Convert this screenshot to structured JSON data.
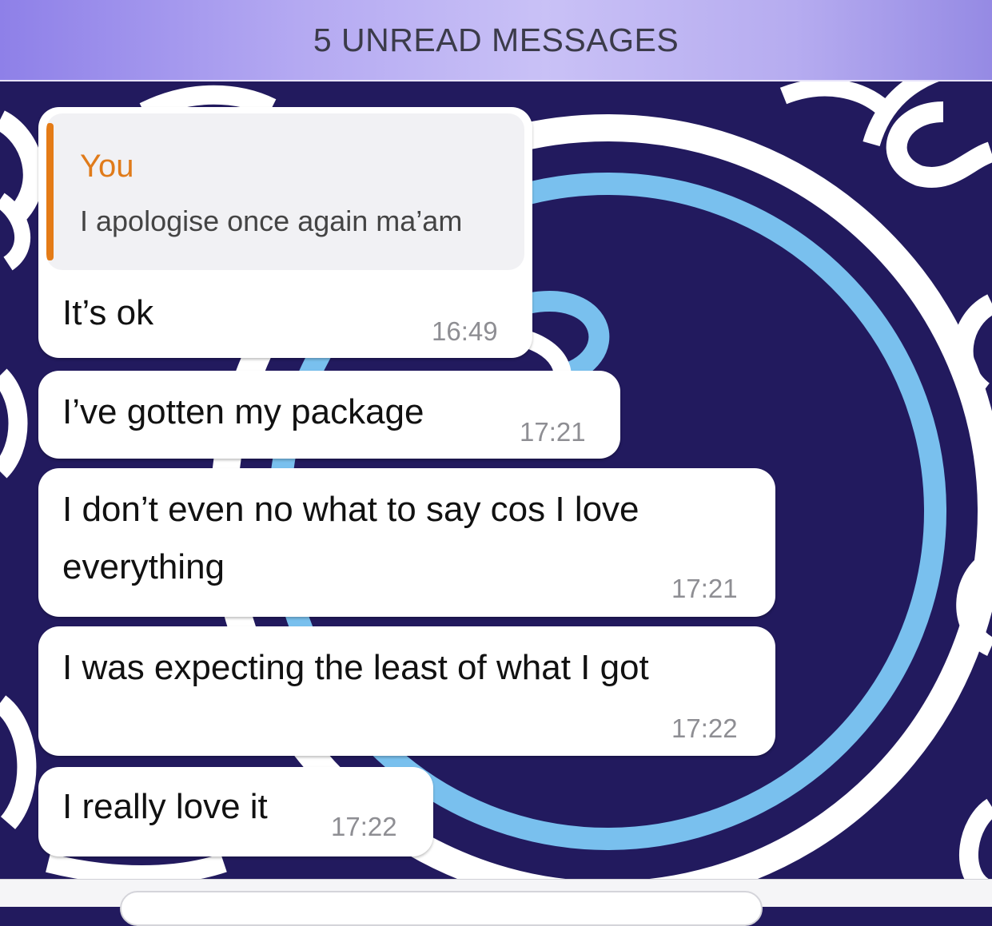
{
  "banner": {
    "label": "5 UNREAD MESSAGES"
  },
  "reply": {
    "author": "You",
    "text": "I apologise once again ma’am"
  },
  "messages": [
    {
      "text": "It’s ok",
      "time": "16:49"
    },
    {
      "text": "I’ve gotten my package",
      "time": "17:21"
    },
    {
      "line1": "I don’t even no what to say cos I love",
      "line2": "everything",
      "time": "17:21"
    },
    {
      "text": "I was expecting the least of what I got",
      "time": "17:22"
    },
    {
      "text": "I really love it",
      "time": "17:22"
    }
  ],
  "colors": {
    "wallpaper": "#221a5e",
    "ring": "#79c0ee",
    "reply_accent": "#e47b16",
    "banner": "#b4a9f2"
  },
  "icons": [
    "reply-accent-bar"
  ]
}
